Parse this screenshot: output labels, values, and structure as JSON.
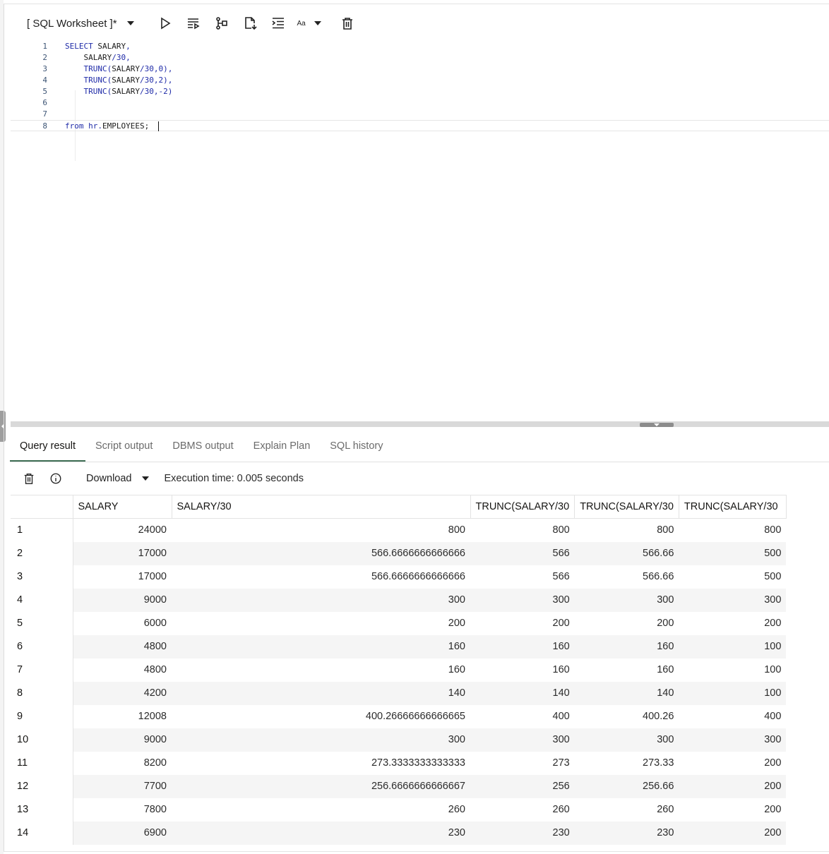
{
  "toolbar": {
    "worksheet_label": "[ SQL Worksheet ]*",
    "font_label": "Aa",
    "icons": [
      "run-statement-icon",
      "run-script-icon",
      "explain-plan-icon",
      "save-file-icon",
      "format-code-icon",
      "clear-icon"
    ]
  },
  "editor": {
    "lines": [
      {
        "num": "1",
        "text": "SELECT SALARY,"
      },
      {
        "num": "2",
        "text": "    SALARY/30,"
      },
      {
        "num": "3",
        "text": "    TRUNC(SALARY/30,0),"
      },
      {
        "num": "4",
        "text": "    TRUNC(SALARY/30,2),"
      },
      {
        "num": "5",
        "text": "    TRUNC(SALARY/30,-2)"
      },
      {
        "num": "6",
        "text": ""
      },
      {
        "num": "7",
        "text": ""
      },
      {
        "num": "8",
        "text": "from hr.EMPLOYEES;"
      }
    ]
  },
  "tabs": [
    "Query result",
    "Script output",
    "DBMS output",
    "Explain Plan",
    "SQL history"
  ],
  "result_bar": {
    "download_label": "Download",
    "execution_time": "Execution time: 0.005 seconds"
  },
  "grid": {
    "headers": [
      "",
      "SALARY",
      "SALARY/30",
      "TRUNC(SALARY/30",
      "TRUNC(SALARY/30",
      "TRUNC(SALARY/30"
    ],
    "rows": [
      [
        "1",
        "24000",
        "800",
        "800",
        "800",
        "800"
      ],
      [
        "2",
        "17000",
        "566.6666666666666",
        "566",
        "566.66",
        "500"
      ],
      [
        "3",
        "17000",
        "566.6666666666666",
        "566",
        "566.66",
        "500"
      ],
      [
        "4",
        "9000",
        "300",
        "300",
        "300",
        "300"
      ],
      [
        "5",
        "6000",
        "200",
        "200",
        "200",
        "200"
      ],
      [
        "6",
        "4800",
        "160",
        "160",
        "160",
        "100"
      ],
      [
        "7",
        "4800",
        "160",
        "160",
        "160",
        "100"
      ],
      [
        "8",
        "4200",
        "140",
        "140",
        "140",
        "100"
      ],
      [
        "9",
        "12008",
        "400.26666666666665",
        "400",
        "400.26",
        "400"
      ],
      [
        "10",
        "9000",
        "300",
        "300",
        "300",
        "300"
      ],
      [
        "11",
        "8200",
        "273.3333333333333",
        "273",
        "273.33",
        "200"
      ],
      [
        "12",
        "7700",
        "256.6666666666667",
        "256",
        "256.66",
        "200"
      ],
      [
        "13",
        "7800",
        "260",
        "260",
        "260",
        "200"
      ],
      [
        "14",
        "6900",
        "230",
        "230",
        "230",
        "200"
      ]
    ]
  }
}
